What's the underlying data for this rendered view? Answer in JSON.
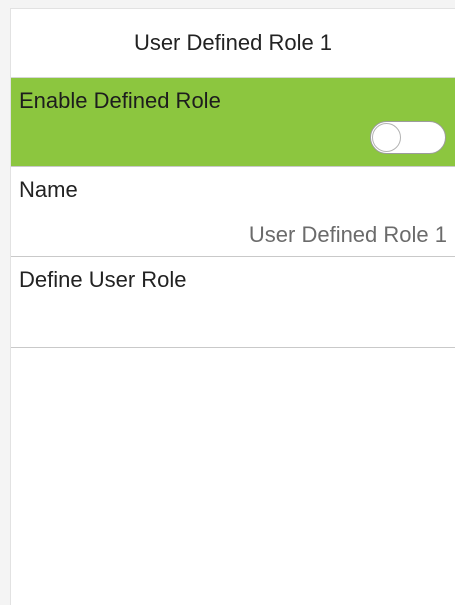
{
  "header": {
    "title": "User Defined Role 1"
  },
  "settings": {
    "enable": {
      "label": "Enable Defined Role",
      "toggle_on": false
    },
    "name": {
      "label": "Name",
      "value": "User Defined Role 1"
    },
    "define_role": {
      "label": "Define User Role"
    }
  },
  "colors": {
    "selected_row": "#8cc63f",
    "background": "#ffffff"
  }
}
